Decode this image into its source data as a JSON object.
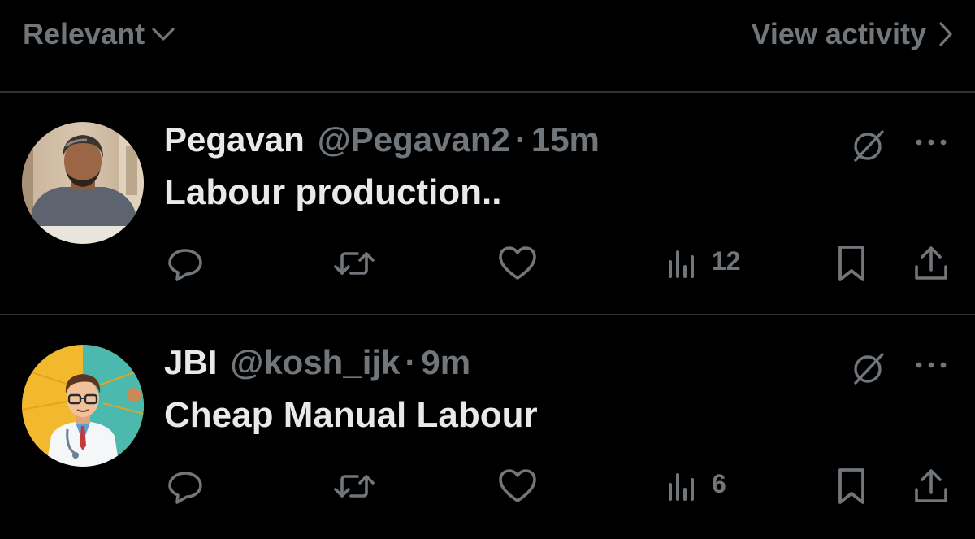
{
  "topbar": {
    "sort_label": "Relevant",
    "view_activity_label": "View activity"
  },
  "tweets": [
    {
      "display_name": "Pegavan",
      "handle": "@Pegavan2",
      "separator": "·",
      "time": "15m",
      "text": "Labour production..",
      "views": "12",
      "avatar": "man-with-beard-portrait"
    },
    {
      "display_name": "JBI",
      "handle": "@kosh_ijk",
      "separator": "·",
      "time": "9m",
      "text": "Cheap Manual Labour",
      "views": "6",
      "avatar": "cartoon-doctor"
    }
  ],
  "icons": {
    "sort": "chevron-down-icon",
    "view_activity": "chevron-right-icon",
    "grok": "grok-icon",
    "more": "more-icon",
    "reply": "reply-icon",
    "retweet": "retweet-icon",
    "like": "heart-icon",
    "views": "views-icon",
    "bookmark": "bookmark-icon",
    "share": "share-icon"
  },
  "colors": {
    "background": "#000000",
    "primary_text": "#e7e9ea",
    "secondary_text": "#71767b",
    "divider": "#2f3336"
  }
}
